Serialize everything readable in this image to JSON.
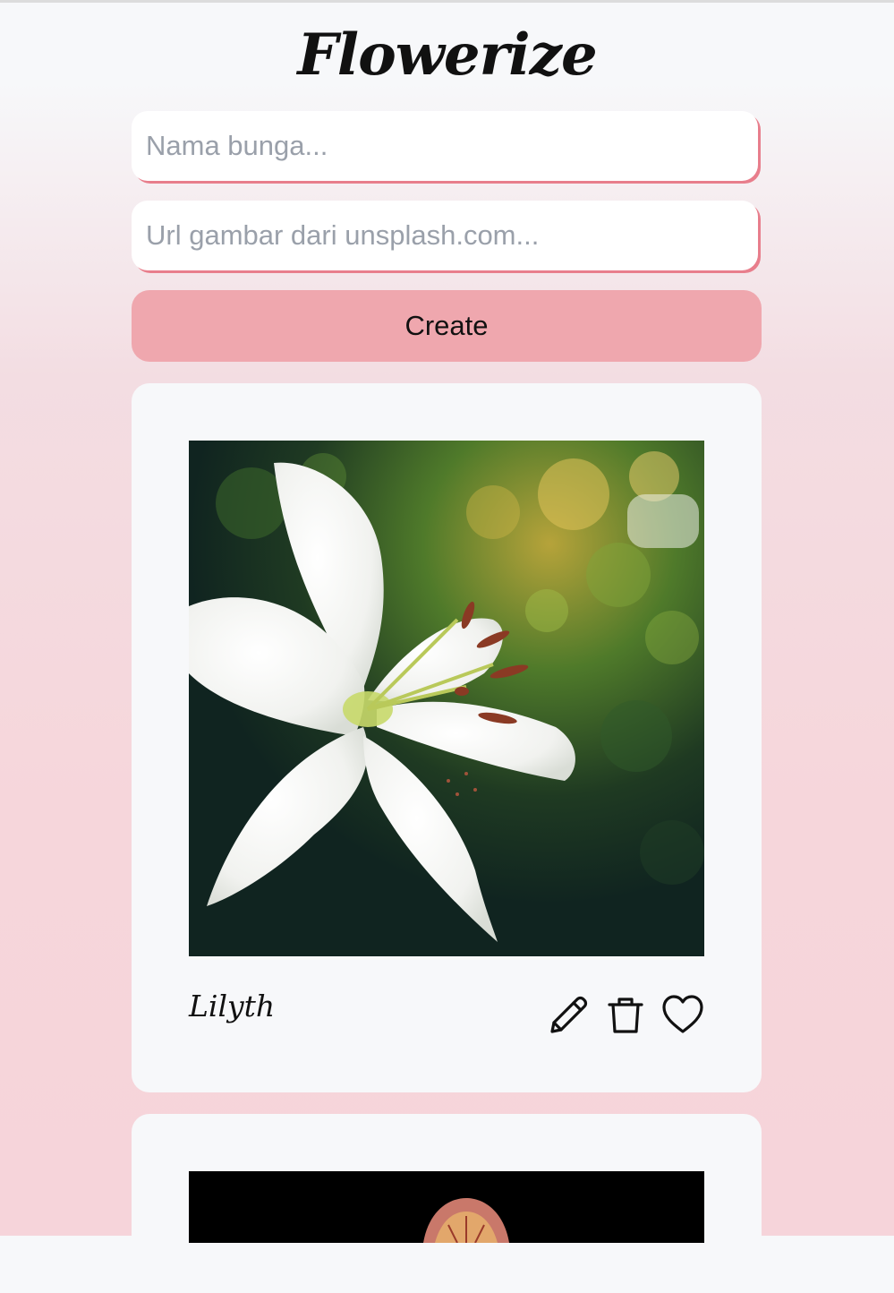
{
  "app": {
    "title": "Flowerize"
  },
  "form": {
    "name_placeholder": "Nama bunga...",
    "name_value": "",
    "url_placeholder": "Url gambar dari unsplash.com...",
    "url_value": "",
    "create_label": "Create"
  },
  "cards": [
    {
      "name": "Lilyth",
      "image": "white-lily-photo",
      "actions": [
        "pencil-icon",
        "trash-icon",
        "heart-icon"
      ]
    },
    {
      "name": "",
      "image": "orchid-photo"
    }
  ],
  "colors": {
    "accent": "#efa7ae",
    "input_shadow": "#e87e8c",
    "card_bg": "#f7f8fa"
  }
}
